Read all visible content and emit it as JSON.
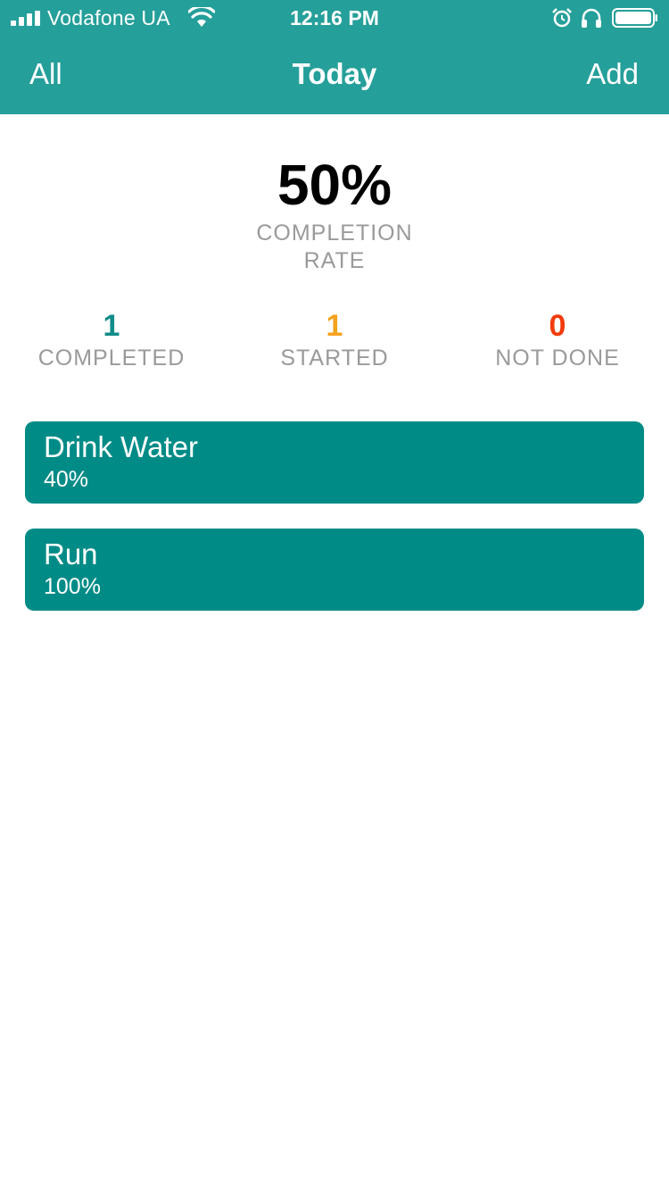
{
  "status_bar": {
    "carrier": "Vodafone UA",
    "time": "12:16 PM",
    "icons": [
      "signal-icon",
      "wifi-icon",
      "alarm-icon",
      "headphones-icon",
      "battery-icon"
    ]
  },
  "nav": {
    "left_label": "All",
    "title": "Today",
    "right_label": "Add"
  },
  "summary": {
    "rate_value": "50%",
    "rate_label_line1": "COMPLETION",
    "rate_label_line2": "RATE"
  },
  "stats": [
    {
      "value": "1",
      "label": "COMPLETED",
      "color": "#108c88"
    },
    {
      "value": "1",
      "label": "STARTED",
      "color": "#f5a21d"
    },
    {
      "value": "0",
      "label": "NOT DONE",
      "color": "#f23b0c"
    }
  ],
  "habits": [
    {
      "name": "Drink Water",
      "percent": "40%"
    },
    {
      "name": "Run",
      "percent": "100%"
    }
  ],
  "colors": {
    "header": "#259f9a",
    "card": "#008b87",
    "muted_text": "#9a9a9a"
  }
}
